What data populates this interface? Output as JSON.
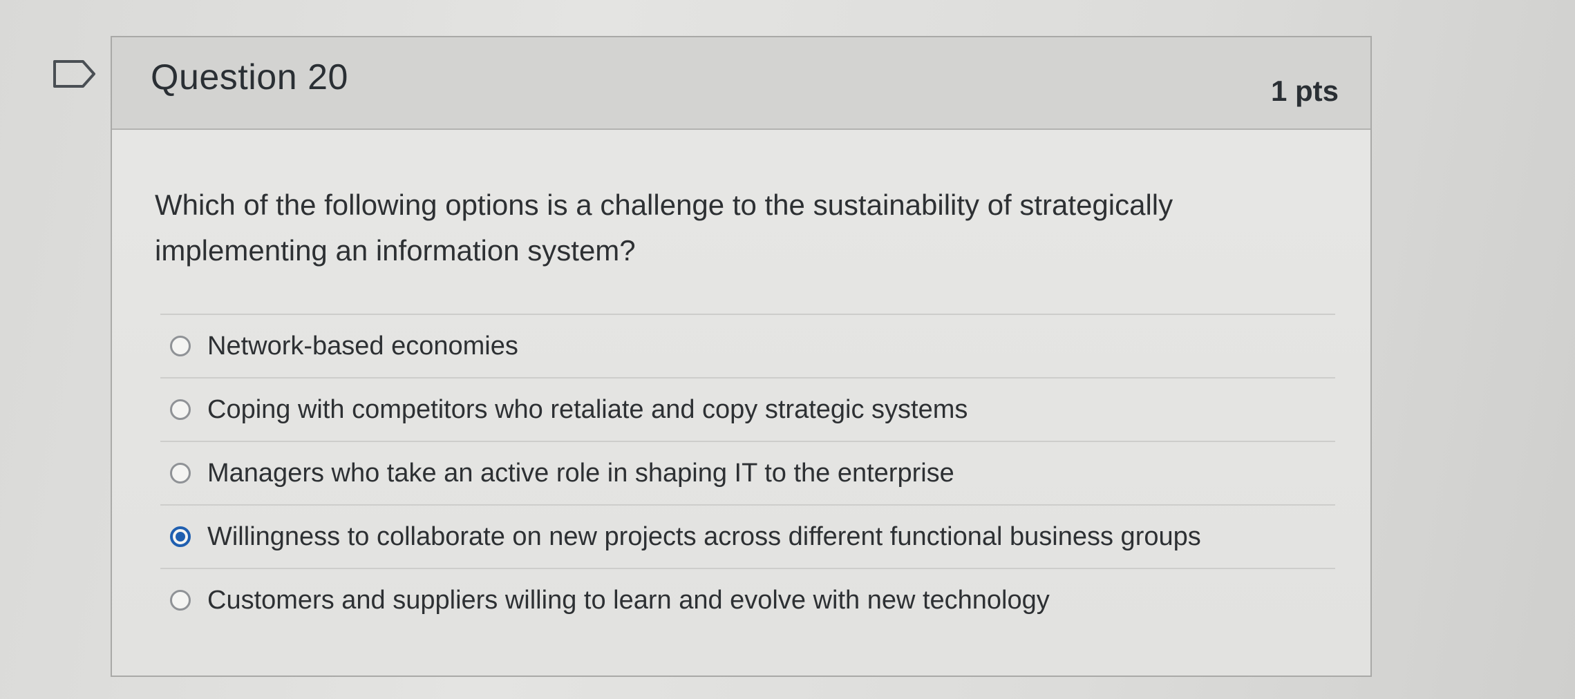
{
  "question": {
    "title": "Question 20",
    "points": "1 pts",
    "text": "Which of the following options is a challenge to the sustainability of strategically implementing an information system?"
  },
  "answers": [
    {
      "label": "Network-based economies",
      "selected": false
    },
    {
      "label": "Coping with competitors who retaliate and copy strategic systems",
      "selected": false
    },
    {
      "label": "Managers who take an active role in shaping IT to the enterprise",
      "selected": false
    },
    {
      "label": "Willingness to collaborate on new projects across different functional business groups",
      "selected": true
    },
    {
      "label": "Customers and suppliers willing to learn and evolve with new technology",
      "selected": false
    }
  ],
  "colors": {
    "accent": "#1f5fb0",
    "header_bg": "#d3d3d1"
  },
  "icons": {
    "flag": "flag-bookmark-icon"
  }
}
